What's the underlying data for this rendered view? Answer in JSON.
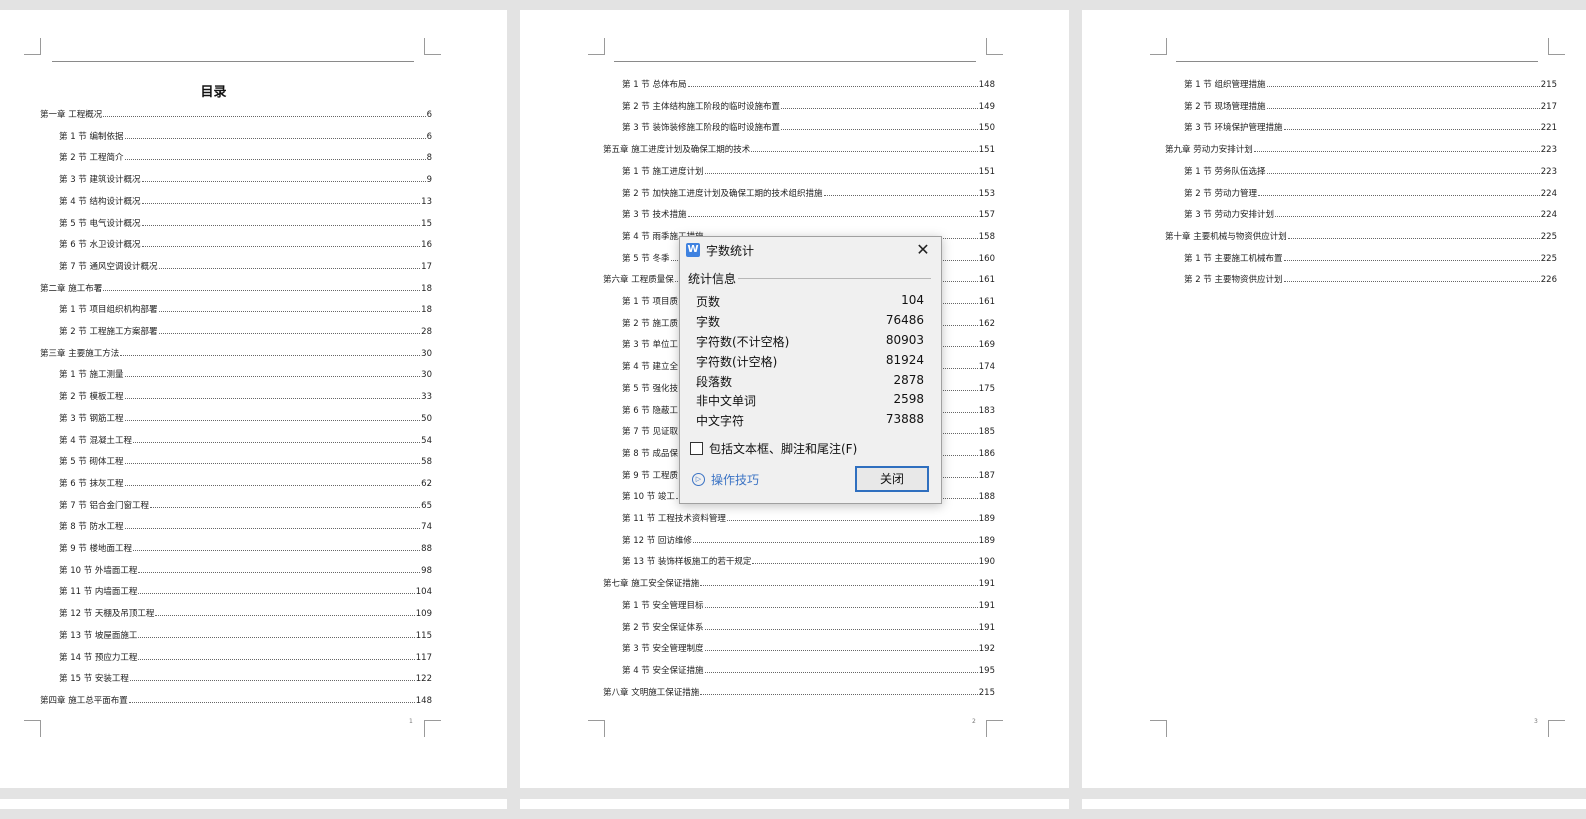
{
  "page1": {
    "title": "目录",
    "page_number": "1",
    "entries": [
      {
        "text": "第一章  工程概况",
        "page": "6",
        "level": 0
      },
      {
        "text": "第 1 节  编制依据",
        "page": "6",
        "level": 1
      },
      {
        "text": "第 2 节  工程简介",
        "page": "8",
        "level": 1
      },
      {
        "text": "第 3 节  建筑设计概况",
        "page": "9",
        "level": 1
      },
      {
        "text": "第 4 节  结构设计概况",
        "page": "13",
        "level": 1
      },
      {
        "text": "第 5 节  电气设计概况",
        "page": "15",
        "level": 1
      },
      {
        "text": "第 6 节  水卫设计概况",
        "page": "16",
        "level": 1
      },
      {
        "text": "第 7 节  通风空调设计概况",
        "page": "17",
        "level": 1
      },
      {
        "text": "第二章  施工布署",
        "page": "18",
        "level": 0
      },
      {
        "text": "第 1 节  项目组织机构部署",
        "page": "18",
        "level": 1
      },
      {
        "text": "第 2 节  工程施工方案部署",
        "page": "28",
        "level": 1
      },
      {
        "text": "第三章  主要施工方法",
        "page": "30",
        "level": 0
      },
      {
        "text": "第 1 节  施工测量",
        "page": "30",
        "level": 1
      },
      {
        "text": "第 2 节  模板工程",
        "page": "33",
        "level": 1
      },
      {
        "text": "第 3 节  钢筋工程",
        "page": "50",
        "level": 1
      },
      {
        "text": "第 4 节  混凝土工程",
        "page": "54",
        "level": 1
      },
      {
        "text": "第 5 节  砌体工程",
        "page": "58",
        "level": 1
      },
      {
        "text": "第 6 节  抹灰工程",
        "page": "62",
        "level": 1
      },
      {
        "text": "第 7 节  铝合金门窗工程",
        "page": "65",
        "level": 1
      },
      {
        "text": "第 8 节  防水工程",
        "page": "74",
        "level": 1
      },
      {
        "text": "第 9 节  楼地面工程",
        "page": "88",
        "level": 1
      },
      {
        "text": "第 10 节  外墙面工程",
        "page": "98",
        "level": 1
      },
      {
        "text": "第 11 节  内墙面工程",
        "page": "104",
        "level": 1
      },
      {
        "text": "第 12 节  天棚及吊顶工程",
        "page": "109",
        "level": 1
      },
      {
        "text": "第 13 节  坡屋面施工",
        "page": "115",
        "level": 1
      },
      {
        "text": "第 14 节  预应力工程",
        "page": "117",
        "level": 1
      },
      {
        "text": "第 15 节  安装工程",
        "page": "122",
        "level": 1
      },
      {
        "text": "第四章  施工总平面布置",
        "page": "148",
        "level": 0
      }
    ]
  },
  "page2": {
    "page_number": "2",
    "entries": [
      {
        "text": "第 1 节  总体布局",
        "page": "148",
        "level": 1
      },
      {
        "text": "第 2 节  主体结构施工阶段的临时设施布置",
        "page": "149",
        "level": 1
      },
      {
        "text": "第 3 节  装饰装修施工阶段的临时设施布置",
        "page": "150",
        "level": 1
      },
      {
        "text": "第五章  施工进度计划及确保工期的技术",
        "page": "151",
        "level": 0
      },
      {
        "text": "第 1 节  施工进度计划",
        "page": "151",
        "level": 1
      },
      {
        "text": "第 2 节  加快施工进度计划及确保工期的技术组织措施",
        "page": "153",
        "level": 1
      },
      {
        "text": "第 3 节  技术措施",
        "page": "157",
        "level": 1
      },
      {
        "text": "第 4 节  雨季施工措施",
        "page": "158",
        "level": 1
      },
      {
        "text": "第 5 节  冬季",
        "page": "160",
        "level": 1
      },
      {
        "text": "第六章  工程质量保",
        "page": "161",
        "level": 0
      },
      {
        "text": "第 1 节  项目质",
        "page": "161",
        "level": 1
      },
      {
        "text": "第 2 节  施工质",
        "page": "162",
        "level": 1
      },
      {
        "text": "第 3 节  单位工",
        "page": "169",
        "level": 1
      },
      {
        "text": "第 4 节  建立全",
        "page": "174",
        "level": 1
      },
      {
        "text": "第 5 节  强化技",
        "page": "175",
        "level": 1
      },
      {
        "text": "第 6 节  隐蔽工",
        "page": "183",
        "level": 1
      },
      {
        "text": "第 7 节  见证取",
        "page": "185",
        "level": 1
      },
      {
        "text": "第 8 节  成品保",
        "page": "186",
        "level": 1
      },
      {
        "text": "第 9 节  工程质",
        "page": "187",
        "level": 1
      },
      {
        "text": "第 10 节  竣工",
        "page": "188",
        "level": 1
      },
      {
        "text": "第 11 节  工程技术资料管理",
        "page": "189",
        "level": 1
      },
      {
        "text": "第 12 节  回访维修",
        "page": "189",
        "level": 1
      },
      {
        "text": "第 13 节  装饰样板施工的若干规定",
        "page": "190",
        "level": 1
      },
      {
        "text": "第七章  施工安全保证措施",
        "page": "191",
        "level": 0
      },
      {
        "text": "第 1 节  安全管理目标",
        "page": "191",
        "level": 1
      },
      {
        "text": "第 2 节  安全保证体系",
        "page": "191",
        "level": 1
      },
      {
        "text": "第 3 节  安全管理制度",
        "page": "192",
        "level": 1
      },
      {
        "text": "第 4 节  安全保证措施",
        "page": "195",
        "level": 1
      },
      {
        "text": "第八章  文明施工保证措施",
        "page": "215",
        "level": 0
      }
    ]
  },
  "page3": {
    "page_number": "3",
    "entries": [
      {
        "text": "第 1 节  组织管理措施",
        "page": "215",
        "level": 1
      },
      {
        "text": "第 2 节  现场管理措施",
        "page": "217",
        "level": 1
      },
      {
        "text": "第 3 节  环境保护管理措施",
        "page": "221",
        "level": 1
      },
      {
        "text": "第九章  劳动力安排计划",
        "page": "223",
        "level": 0
      },
      {
        "text": "第 1 节  劳务队伍选择",
        "page": "223",
        "level": 1
      },
      {
        "text": "第 2 节  劳动力管理",
        "page": "224",
        "level": 1
      },
      {
        "text": "第 3 节  劳动力安排计划",
        "page": "224",
        "level": 1
      },
      {
        "text": "第十章  主要机械与物资供应计划",
        "page": "225",
        "level": 0
      },
      {
        "text": "第 1 节  主要施工机械布置",
        "page": "225",
        "level": 1
      },
      {
        "text": "第 2 节  主要物资供应计划",
        "page": "226",
        "level": 1
      }
    ]
  },
  "dialog": {
    "title": "字数统计",
    "app_icon": "W",
    "section": "统计信息",
    "stats": [
      {
        "label": "页数",
        "value": "104"
      },
      {
        "label": "字数",
        "value": "76486"
      },
      {
        "label": "字符数(不计空格)",
        "value": "80903"
      },
      {
        "label": "字符数(计空格)",
        "value": "81924"
      },
      {
        "label": "段落数",
        "value": "2878"
      },
      {
        "label": "非中文单词",
        "value": "2598"
      },
      {
        "label": "中文字符",
        "value": "73888"
      }
    ],
    "checkbox_label": "包括文本框、脚注和尾注(F)",
    "checkbox_checked": false,
    "tips_label": "操作技巧",
    "close_button": "关闭"
  }
}
